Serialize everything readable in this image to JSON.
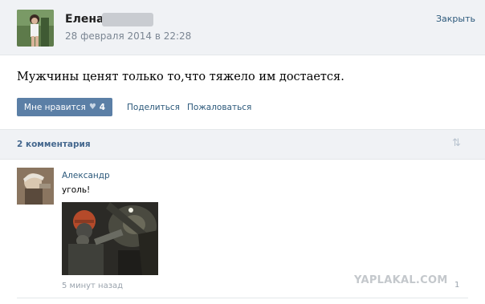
{
  "post": {
    "author_name": "Елена",
    "date": "28 февраля 2014 в 22:28",
    "close_label": "Закрыть",
    "text": "Мужчины ценят только то,что тяжело им достается.",
    "like_label": "Мне нравится",
    "like_count": "4",
    "share_label": "Поделиться",
    "report_label": "Пожаловаться"
  },
  "comments": {
    "count_label": "2 комментария",
    "items": [
      {
        "author": "Александр",
        "text": "уголь!",
        "time": "5 минут назад",
        "likes": "1"
      }
    ]
  },
  "watermark": "YAPLAKAL.COM",
  "colors": {
    "link": "#2b587a",
    "button": "#5b7fa6",
    "header_bg": "#f0f2f5"
  }
}
